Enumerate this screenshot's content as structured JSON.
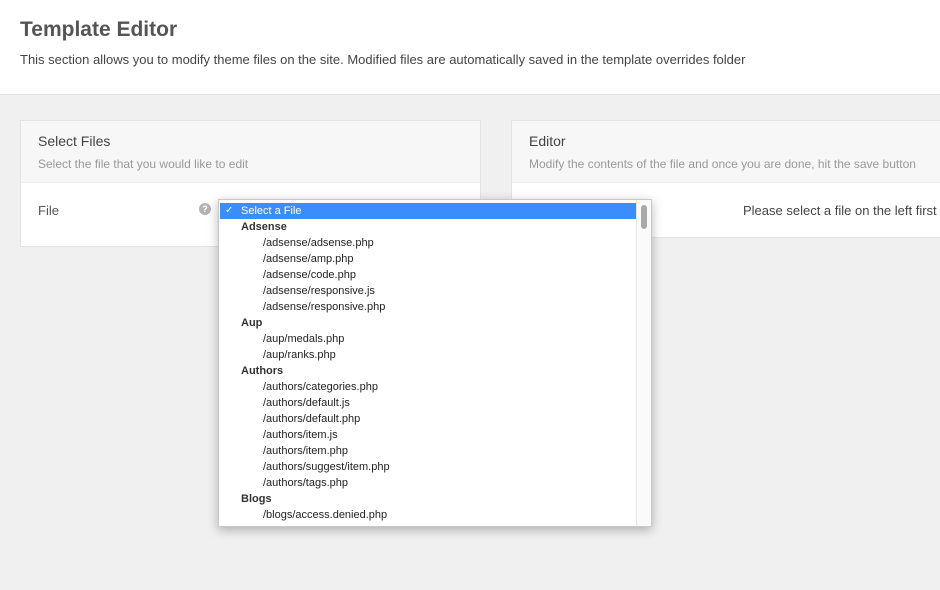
{
  "header": {
    "title": "Template Editor",
    "description": "This section allows you to modify theme files on the site. Modified files are automatically saved in the template overrides folder"
  },
  "select_files_panel": {
    "title": "Select Files",
    "subtitle": "Select the file that you would like to edit",
    "file_label": "File",
    "help_icon": "?"
  },
  "editor_panel": {
    "title": "Editor",
    "subtitle": "Modify the contents of the file and once you are done, hit the save button",
    "message": "Please select a file on the left first"
  },
  "file_select": {
    "selected_mark": "✓",
    "selected_option": "Select a File",
    "groups": [
      {
        "label": "Adsense",
        "options": [
          "/adsense/adsense.php",
          "/adsense/amp.php",
          "/adsense/code.php",
          "/adsense/responsive.js",
          "/adsense/responsive.php"
        ]
      },
      {
        "label": "Aup",
        "options": [
          "/aup/medals.php",
          "/aup/ranks.php"
        ]
      },
      {
        "label": "Authors",
        "options": [
          "/authors/categories.php",
          "/authors/default.js",
          "/authors/default.php",
          "/authors/item.js",
          "/authors/item.php",
          "/authors/suggest/item.php",
          "/authors/tags.php"
        ]
      },
      {
        "label": "Blogs",
        "options": [
          "/blogs/access.denied.php"
        ]
      }
    ]
  }
}
